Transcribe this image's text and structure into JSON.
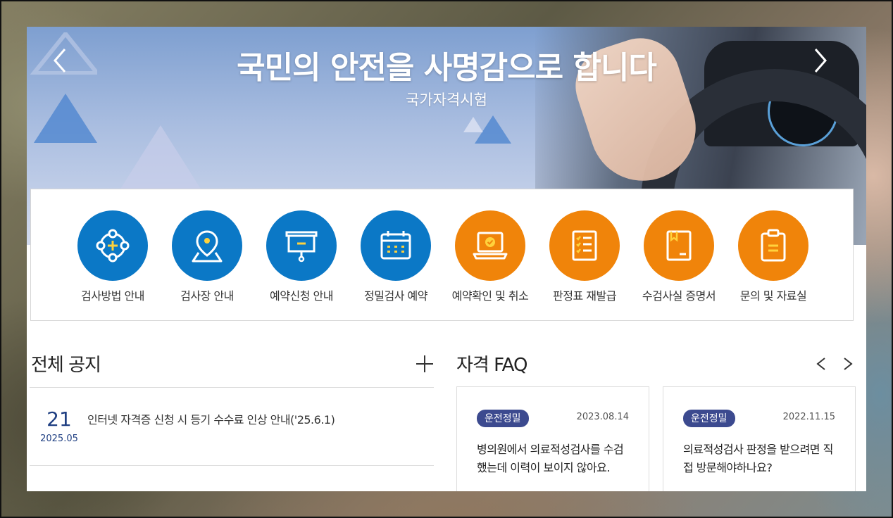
{
  "banner": {
    "title": "국민의 안전을 사명감으로 합니다",
    "subtitle": "국가자격시험",
    "prev_icon": "chevron-left-icon",
    "next_icon": "chevron-right-icon"
  },
  "quick_menu": [
    {
      "label": "검사방법 안내",
      "icon": "crosshair-icon",
      "color": "#0b78c6"
    },
    {
      "label": "검사장 안내",
      "icon": "map-pin-icon",
      "color": "#0b78c6"
    },
    {
      "label": "예약신청 안내",
      "icon": "presentation-board-icon",
      "color": "#0b78c6"
    },
    {
      "label": "정밀검사 예약",
      "icon": "calendar-icon",
      "color": "#0b78c6"
    },
    {
      "label": "예약확인 및 취소",
      "icon": "laptop-check-icon",
      "color": "#f0840a"
    },
    {
      "label": "판정표 재발급",
      "icon": "checklist-icon",
      "color": "#f0840a"
    },
    {
      "label": "수검사실 증명서",
      "icon": "certificate-book-icon",
      "color": "#f0840a"
    },
    {
      "label": "문의 및 자료실",
      "icon": "clipboard-icon",
      "color": "#f0840a"
    }
  ],
  "notices": {
    "heading": "전체 공지",
    "more_icon": "plus-icon",
    "items": [
      {
        "day": "21",
        "year_month": "2025.05",
        "title": "인터넷 자격증 신청 시 등기 수수료 인상 안내('25.6.1)"
      }
    ]
  },
  "faq": {
    "heading": "자격 FAQ",
    "prev_icon": "chevron-left-icon",
    "next_icon": "chevron-right-icon",
    "cards": [
      {
        "badge": "운전정밀",
        "date": "2023.08.14",
        "question": "병의원에서 의료적성검사를 수검했는데 이력이 보이지 않아요."
      },
      {
        "badge": "운전정밀",
        "date": "2022.11.15",
        "question": "의료적성검사 판정을 받으려면 직접 방문해야하나요?"
      }
    ]
  },
  "colors": {
    "blue": "#0b78c6",
    "orange": "#f0840a",
    "navy": "#1f3f82",
    "badge": "#3c4a8f"
  }
}
